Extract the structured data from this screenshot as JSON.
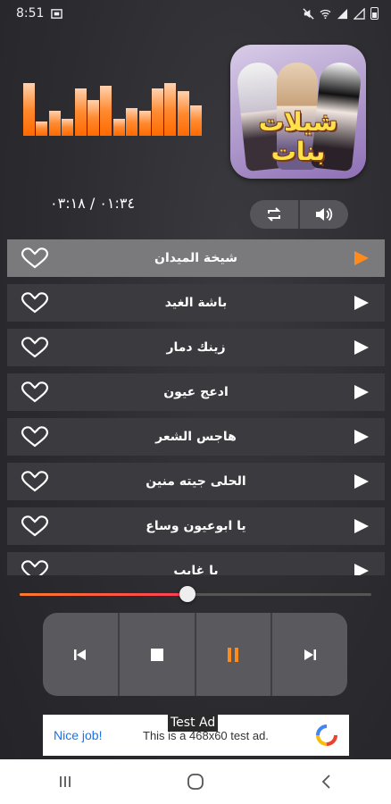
{
  "status": {
    "time": "8:51"
  },
  "album": {
    "title": "شيلات بنات"
  },
  "player": {
    "time_display": "٠١:٣٤ / ٠٣:١٨",
    "elapsed_fraction": 0.477,
    "equalizer_levels": [
      0.95,
      0.25,
      0.45,
      0.3,
      0.85,
      0.65,
      0.9,
      0.3,
      0.5,
      0.45,
      0.85,
      0.95,
      0.8,
      0.55
    ]
  },
  "playlist": [
    {
      "title": "شيخة الميدان",
      "active": true
    },
    {
      "title": "باشة الغيد",
      "active": false
    },
    {
      "title": "زينك دمار",
      "active": false
    },
    {
      "title": "ادعج عيون",
      "active": false
    },
    {
      "title": "هاجس الشعر",
      "active": false
    },
    {
      "title": "الحلى جيته منين",
      "active": false
    },
    {
      "title": "يا ابوعيون وساع",
      "active": false
    },
    {
      "title": "يا غايب",
      "active": false
    }
  ],
  "ad": {
    "tag": "Test Ad",
    "cta": "Nice job!",
    "message": "This is a 468x60 test ad."
  },
  "colors": {
    "accent": "#ff8c1a",
    "row": "#3b3b3f",
    "row_active": "#7a7a7d"
  }
}
